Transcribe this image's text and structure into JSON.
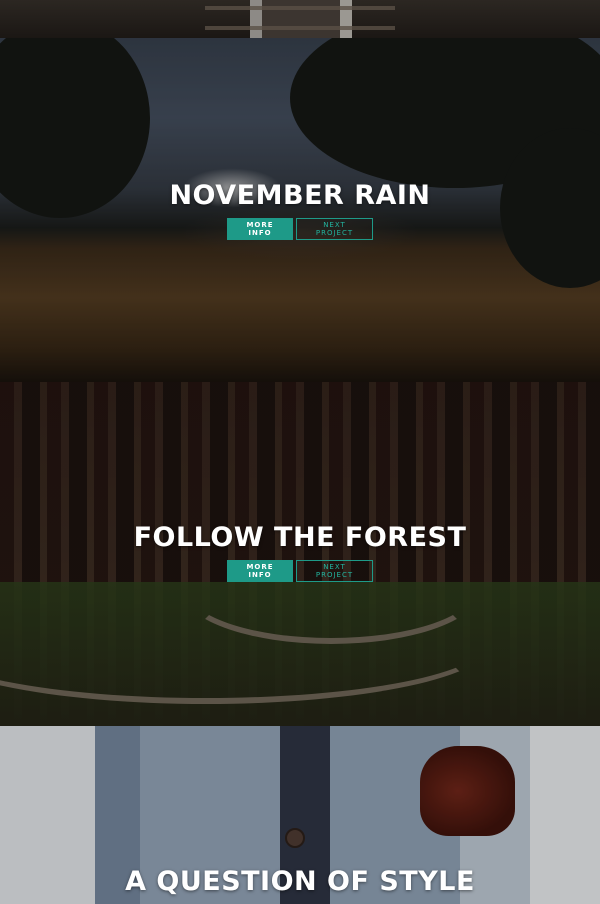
{
  "sections": [
    {
      "title": "NOVEMBER RAIN",
      "more_info": "MORE INFO",
      "next_project": "NEXT PROJECT"
    },
    {
      "title": "FOLLOW THE FOREST",
      "more_info": "MORE INFO",
      "next_project": "NEXT PROJECT"
    },
    {
      "title": "A QUESTION OF STYLE"
    }
  ],
  "colors": {
    "accent": "#1e9a88",
    "accent_text": "#22b39e",
    "title": "#ffffff"
  }
}
